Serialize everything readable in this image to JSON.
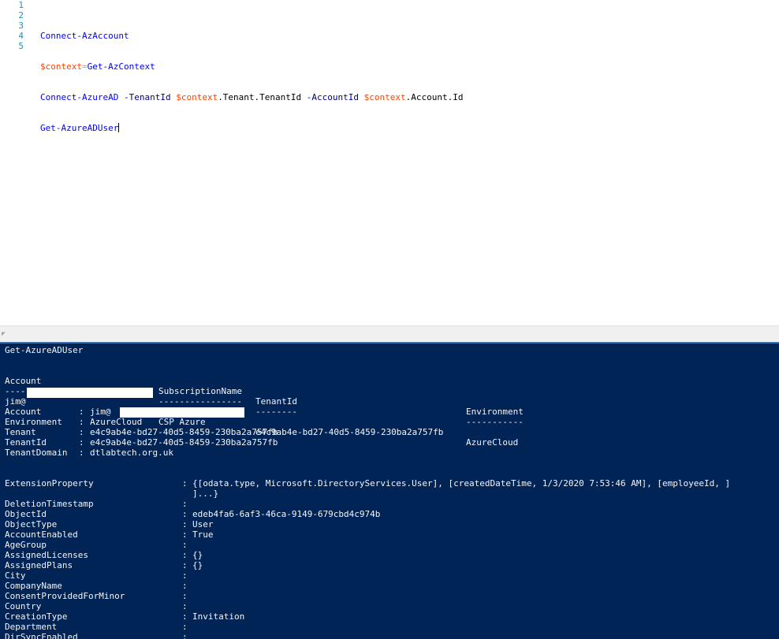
{
  "editor": {
    "line_numbers": [
      "1",
      "2",
      "3",
      "4",
      "5"
    ],
    "line2": {
      "cmd": "Connect-AzAccount"
    },
    "line3": {
      "var": "$context",
      "op": "=",
      "cmd": "Get-AzContext"
    },
    "line4": {
      "cmd": "Connect-AzureAD",
      "p1": " -TenantId ",
      "v1": "$context",
      "m1": ".Tenant.TenantId",
      "p2": " -AccountId ",
      "v2": "$context",
      "m2": ".Account.Id"
    },
    "line5": {
      "cmd": "Get-AzureADUser"
    }
  },
  "console": {
    "command": "Get-AzureADUser",
    "table_headers": [
      "Account",
      "SubscriptionName",
      "TenantId",
      "Environment"
    ],
    "table_dashes": [
      "-------",
      "----------------",
      "--------",
      "-----------"
    ],
    "table_row": [
      "jim@",
      "CSP Azure",
      "e4c9ab4e-bd27-40d5-8459-230ba2a757fb",
      "AzureCloud"
    ],
    "connect_ad": [
      {
        "key": "Account      ",
        "value": "jim@"
      },
      {
        "key": "Environment  ",
        "value": "AzureCloud"
      },
      {
        "key": "Tenant       ",
        "value": "e4c9ab4e-bd27-40d5-8459-230ba2a757fb"
      },
      {
        "key": "TenantId     ",
        "value": "e4c9ab4e-bd27-40d5-8459-230ba2a757fb"
      },
      {
        "key": "TenantDomain ",
        "value": "dtlabtech.org.uk"
      }
    ],
    "user_props": [
      {
        "key": "ExtensionProperty",
        "value": "{[odata.type, Microsoft.DirectoryServices.User], [createdDateTime, 1/3/2020 7:53:46 AM], [employeeId, ]"
      },
      {
        "key": "",
        "value": "]...}"
      },
      {
        "key": "DeletionTimestamp",
        "value": ""
      },
      {
        "key": "ObjectId",
        "value": "edeb4fa6-6af3-46ca-9149-679cbd4c974b"
      },
      {
        "key": "ObjectType",
        "value": "User"
      },
      {
        "key": "AccountEnabled",
        "value": "True"
      },
      {
        "key": "AgeGroup",
        "value": ""
      },
      {
        "key": "AssignedLicenses",
        "value": "{}"
      },
      {
        "key": "AssignedPlans",
        "value": "{}"
      },
      {
        "key": "City",
        "value": ""
      },
      {
        "key": "CompanyName",
        "value": ""
      },
      {
        "key": "ConsentProvidedForMinor",
        "value": ""
      },
      {
        "key": "Country",
        "value": ""
      },
      {
        "key": "CreationType",
        "value": "Invitation"
      },
      {
        "key": "Department",
        "value": ""
      },
      {
        "key": "DirSyncEnabled",
        "value": ""
      }
    ],
    "separator": ":"
  },
  "colors": {
    "console_bg": "#012456",
    "console_fg": "#f5f5f5",
    "cmdlet": "#0000ff",
    "variable": "#ff4500",
    "line_number": "#2b91af"
  }
}
